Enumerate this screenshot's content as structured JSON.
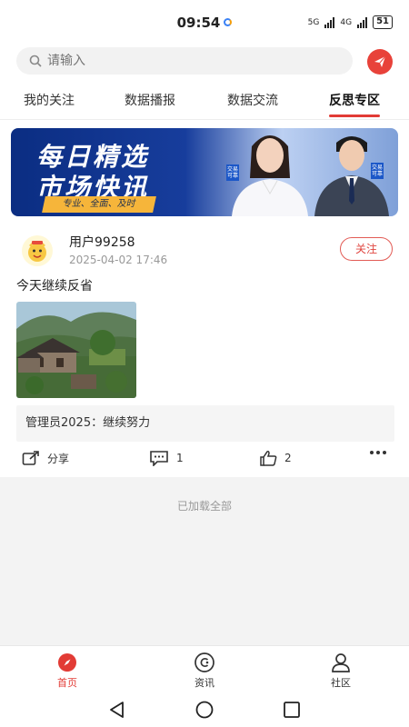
{
  "status": {
    "time": "09:54",
    "net1": "5G",
    "net2": "4G",
    "battery": "51"
  },
  "search": {
    "placeholder": "请输入"
  },
  "tabs": [
    {
      "label": "我的关注"
    },
    {
      "label": "数据播报"
    },
    {
      "label": "数据交流"
    },
    {
      "label": "反思专区"
    }
  ],
  "banner": {
    "title1": "每日精选",
    "title2": "市场快讯",
    "subtitle": "专业、全面、及时",
    "tag_left": "交易可靠",
    "tag_right": "交易可靠"
  },
  "post": {
    "username": "用户99258",
    "time": "2025-04-02 17:46",
    "follow_label": "关注",
    "text": "今天继续反省",
    "comment": "管理员2025：继续努力",
    "share_label": "分享",
    "comment_count": "1",
    "like_count": "2"
  },
  "footer": {
    "loaded_text": "已加载全部"
  },
  "bottom_nav": [
    {
      "label": "首页"
    },
    {
      "label": "资讯"
    },
    {
      "label": "社区"
    }
  ],
  "colors": {
    "accent": "#e23b35",
    "banner_blue": "#173d9c"
  }
}
